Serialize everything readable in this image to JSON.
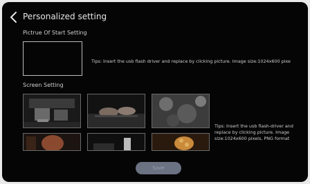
{
  "header": {
    "title": "Personalized setting",
    "back_icon": "chevron-left-icon"
  },
  "start_section": {
    "label": "Pictrue Of Start Setting",
    "tip": "Tips: Insert the usb flash driver and replace by clicking picture. Image size:1024x600 pixe"
  },
  "screen_section": {
    "label": "Screen Setting",
    "tip": "Tips: Insert the usb flash-driver and replace by clicking picture. Image size:1024x600 pixels, PNG format",
    "thumbnails": [
      {
        "subject": "coffee-machine-photo"
      },
      {
        "subject": "hands-on-keyboard-photo"
      },
      {
        "subject": "grey-texture-photo"
      },
      {
        "subject": "person-photo"
      },
      {
        "subject": "laptop-desk-photo"
      },
      {
        "subject": "golden-food-photo"
      }
    ]
  },
  "footer": {
    "save_label": "Save"
  },
  "colors": {
    "background": "#050505",
    "save_button": "#6b7282",
    "text": "#e6e6e6"
  }
}
